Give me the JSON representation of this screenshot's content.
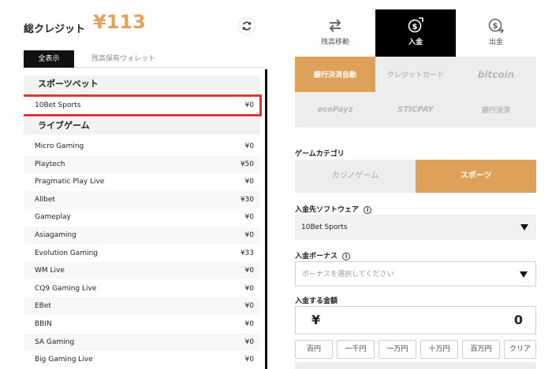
{
  "header": {
    "credit_label": "総クレジット",
    "credit_amount": "¥113"
  },
  "left_tabs": [
    "全表示",
    "残高保有ウォレット"
  ],
  "categories": [
    {
      "title": "スポーツベット",
      "items": [
        {
          "name": "10Bet Sports",
          "value": "¥0"
        }
      ]
    },
    {
      "title": "ライブゲーム",
      "items": [
        {
          "name": "Micro Gaming",
          "value": "¥0"
        },
        {
          "name": "Playtech",
          "value": "¥50"
        },
        {
          "name": "Pragmatic Play Live",
          "value": "¥0"
        },
        {
          "name": "Allbet",
          "value": "¥30"
        },
        {
          "name": "Gameplay",
          "value": "¥0"
        },
        {
          "name": "Asiagaming",
          "value": "¥0"
        },
        {
          "name": "Evolution Gaming",
          "value": "¥33"
        },
        {
          "name": "WM Live",
          "value": "¥0"
        },
        {
          "name": "CQ9 Gaming Live",
          "value": "¥0"
        },
        {
          "name": "EBet",
          "value": "¥0"
        },
        {
          "name": "BBIN",
          "value": "¥0"
        },
        {
          "name": "SA Gaming",
          "value": "¥0"
        },
        {
          "name": "Big Gaming Live",
          "value": "¥0"
        }
      ]
    }
  ],
  "right_tabs": [
    "残高移動",
    "入金",
    "出金"
  ],
  "payment_methods": [
    "銀行決済自動",
    "クレジットカード",
    "bitcoin",
    "ecoPayz",
    "STICPAY",
    "銀行決済"
  ],
  "game_category": {
    "label": "ゲームカテゴリ",
    "options": [
      "カジノゲーム",
      "スポーツ"
    ]
  },
  "software": {
    "label": "入金先ソフトウェア",
    "value": "10Bet Sports"
  },
  "bonus": {
    "label": "入金ボーナス",
    "placeholder": "ボーナスを選択してください"
  },
  "amount": {
    "label": "入金する金額",
    "currency": "¥",
    "value": "0"
  },
  "quick_amounts": [
    "百円",
    "一千円",
    "一万円",
    "十万円",
    "百万円",
    "クリア"
  ],
  "colors": {
    "accent": "#dda15a",
    "highlight": "#e8302f"
  }
}
